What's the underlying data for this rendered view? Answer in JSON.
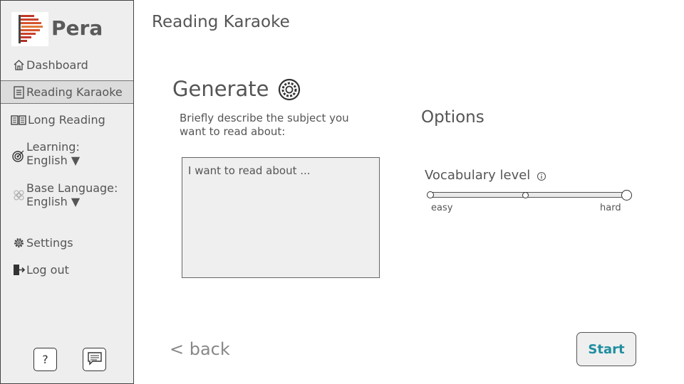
{
  "app": {
    "name": "Pera"
  },
  "sidebar": {
    "items": [
      {
        "label": "Dashboard",
        "icon": "home-icon"
      },
      {
        "label": "Reading Karaoke",
        "icon": "document-icon",
        "active": true
      },
      {
        "label": "Long Reading",
        "icon": "book-icon"
      },
      {
        "label": "Learning:",
        "value": "English ▼",
        "icon": "target-icon"
      },
      {
        "label": "Base Language:",
        "value": "English ▼",
        "icon": "globe-icon"
      },
      {
        "label": "Settings",
        "icon": "gear-icon"
      },
      {
        "label": "Log out",
        "icon": "logout-icon"
      }
    ],
    "help_label": "?"
  },
  "main": {
    "page_title": "Reading Karaoke",
    "generate_title": "Generate",
    "prompt_label": "Briefly describe the subject you want to read about:",
    "input_placeholder": "I want to read about ...",
    "options_title": "Options",
    "vocab_label": "Vocabulary level",
    "slider": {
      "min_label": "easy",
      "max_label": "hard",
      "value": 1.0
    },
    "back_label": "< back",
    "start_label": "Start"
  },
  "colors": {
    "accent": "#1f8ea0",
    "sidebar_bg": "#eeeeee",
    "logo_red": "#c0392b"
  }
}
